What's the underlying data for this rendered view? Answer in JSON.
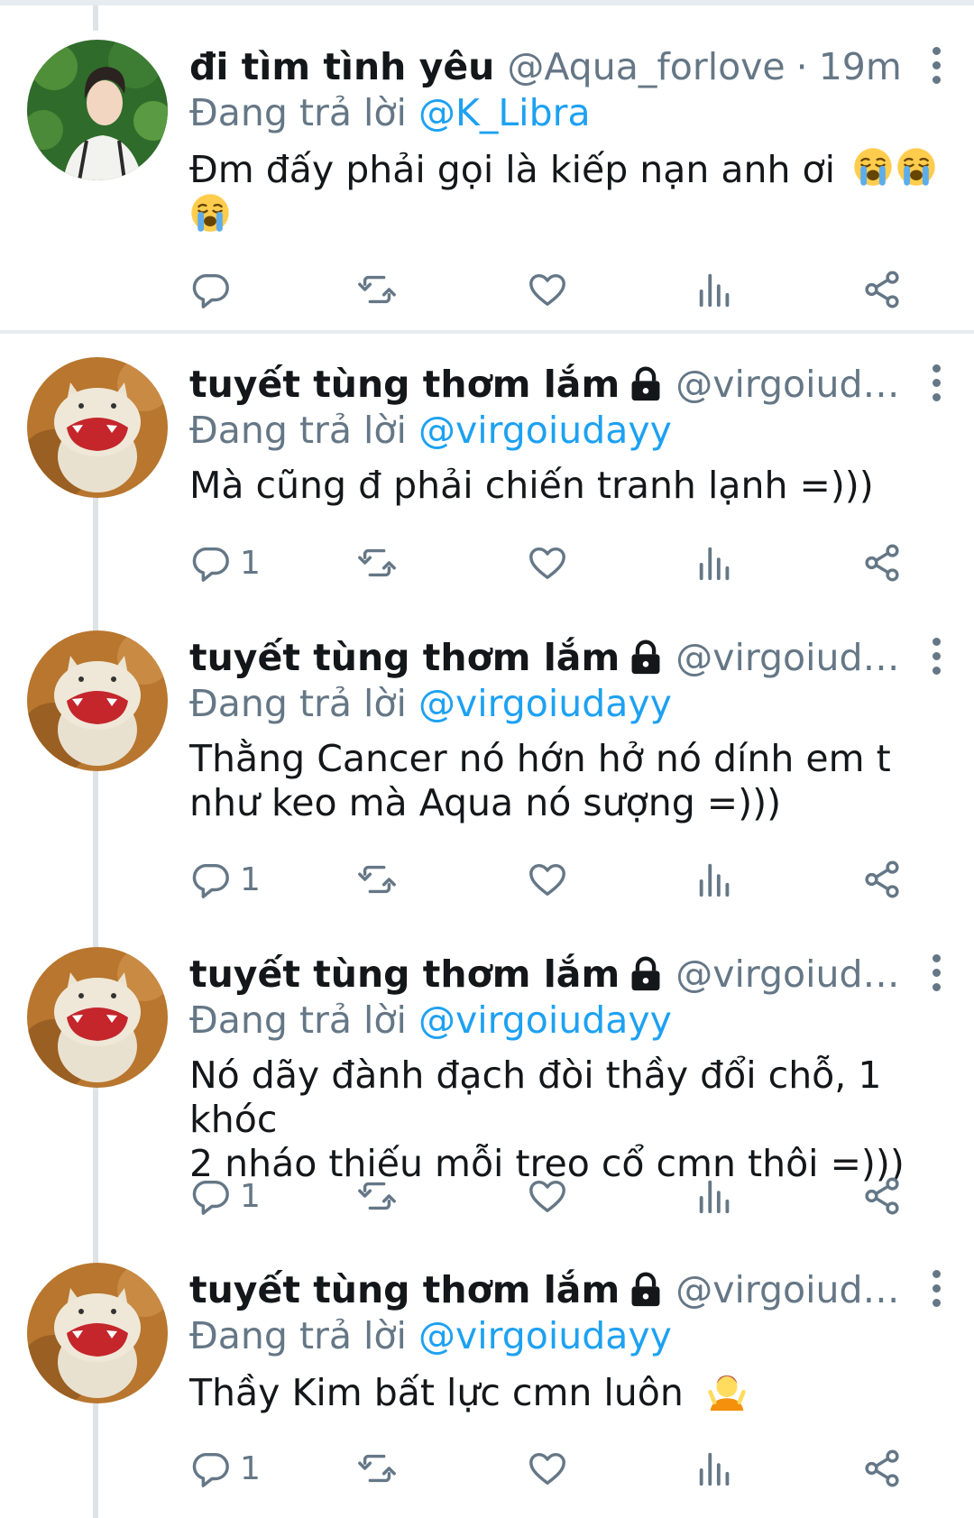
{
  "tweets": [
    {
      "name": "đi tìm tình yêu",
      "handle": "@Aqua_forlove",
      "separator": "·",
      "time": "19m",
      "protected": false,
      "reply_prefix": "Đang trả lời",
      "reply_to": "@K_Libra",
      "text": "Đm đấy phải gọi là kiếp nạn anh ơi",
      "emojis": [
        "crying-face-icon",
        "crying-face-icon",
        "crying-face-icon"
      ],
      "reply_count": ""
    },
    {
      "name": "tuyết tùng thơm lắm",
      "handle": "@virgoiudayy",
      "protected": true,
      "reply_prefix": "Đang trả lời",
      "reply_to": "@virgoiudayy",
      "text": "Mà cũng đ phải chiến tranh lạnh =)))",
      "reply_count": "1"
    },
    {
      "name": "tuyết tùng thơm lắm",
      "handle": "@virgoiudayy",
      "protected": true,
      "reply_prefix": "Đang trả lời",
      "reply_to": "@virgoiudayy",
      "text_line1": "Thằng Cancer nó hớn hở nó dính em t",
      "text_line2": "như keo mà Aqua nó sượng =)))",
      "reply_count": "1"
    },
    {
      "name": "tuyết tùng thơm lắm",
      "handle": "@virgoiudayy",
      "protected": true,
      "reply_prefix": "Đang trả lời",
      "reply_to": "@virgoiudayy",
      "text_line1": "Nó dãy đành đạch đòi thầy đổi chỗ, 1 khóc",
      "text_line2": "2 nháo thiếu mỗi treo cổ cmn thôi =)))",
      "reply_count": "1"
    },
    {
      "name": "tuyết tùng thơm lắm",
      "handle": "@virgoiudayy",
      "protected": true,
      "reply_prefix": "Đang trả lời",
      "reply_to": "@virgoiudayy",
      "text": "Thầy Kim bất lực cmn luôn",
      "emojis": [
        "person-shrugging-icon"
      ],
      "reply_count": "1"
    }
  ],
  "colors": {
    "accent": "#1da1f2",
    "muted": "#657786",
    "text": "#14171a",
    "thread": "#dfe3e6"
  }
}
